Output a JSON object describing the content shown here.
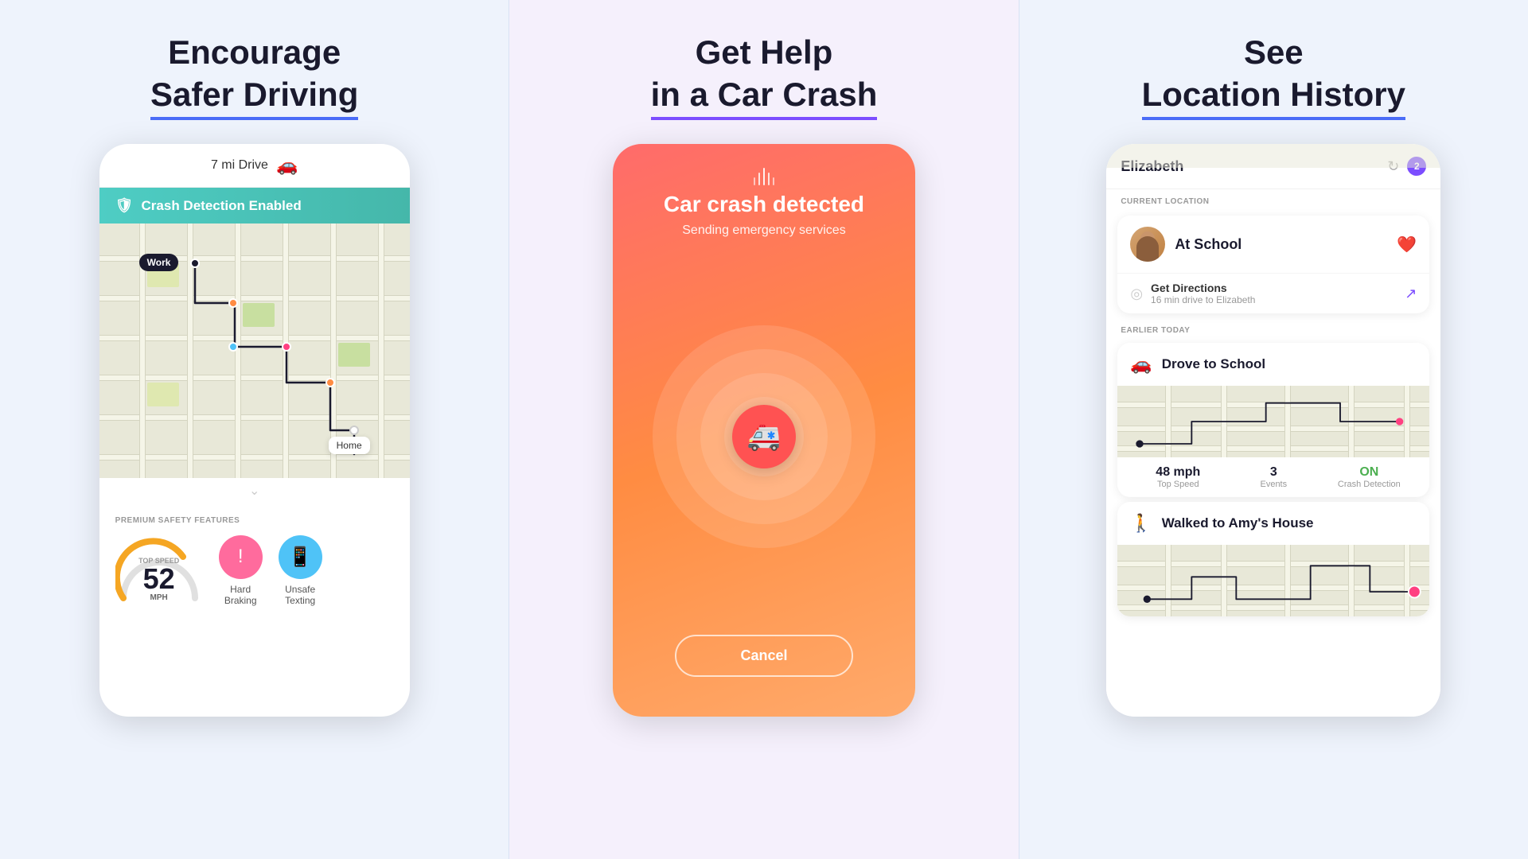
{
  "panel1": {
    "heading_line1": "Encourage",
    "heading_line2": "Safer Driving",
    "drive_header": "7 mi Drive",
    "crash_banner": "Crash Detection Enabled",
    "work_label": "Work",
    "home_label": "Home",
    "premium_label": "PREMIUM SAFETY FEATURES",
    "top_speed_label": "TOP SPEED",
    "speed_number": "52",
    "speed_unit": "MPH",
    "stat1_label": "Hard\nBraking",
    "stat2_label": "Unsafe\nTexting"
  },
  "panel2": {
    "heading_line1": "Get Help",
    "heading_line2": "in a Car Crash",
    "crash_title": "Car crash detected",
    "crash_subtitle": "Sending emergency services",
    "cancel_label": "Cancel",
    "ambulance_icon": "🚑"
  },
  "panel3": {
    "heading_line1": "See",
    "heading_line2": "Location History",
    "user_name": "Elizabeth",
    "badge_count": "2",
    "current_location_label": "CURRENT LOCATION",
    "at_school": "At School",
    "get_directions": "Get Directions",
    "drive_time": "16 min drive to Elizabeth",
    "earlier_today_label": "EARLIER TODAY",
    "drove_to_school": "Drove to School",
    "top_speed_val": "48 mph",
    "top_speed_lbl": "Top Speed",
    "events_val": "3",
    "events_lbl": "Events",
    "crash_detection_val": "ON",
    "crash_detection_lbl": "Crash Detection",
    "walked_to_amy": "Walked to Amy's House"
  }
}
